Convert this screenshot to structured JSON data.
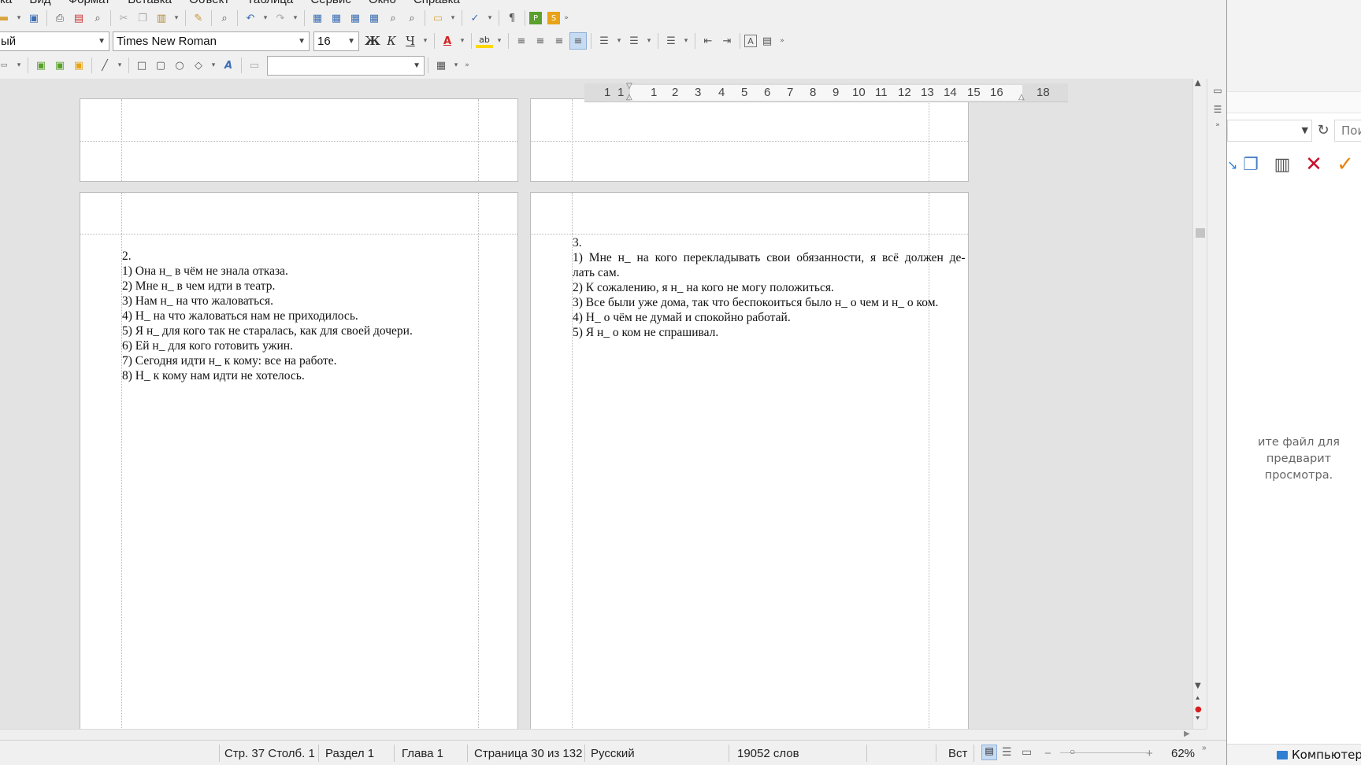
{
  "menubar": {
    "items": [
      "ка",
      "Вид",
      "Формат",
      "Вставка",
      "Объект",
      "Таблица",
      "Сервис",
      "Окно",
      "Справка"
    ]
  },
  "toolbar": {
    "paragraph_style": "ый",
    "font_name": "Times New Roman",
    "font_size": "16",
    "bold_label": "Ж",
    "italic_label": "К",
    "underline_label": "Ч",
    "more_label": "»"
  },
  "ruler": {
    "labels": [
      "1",
      "1",
      "1",
      "2",
      "3",
      "4",
      "5",
      "6",
      "7",
      "8",
      "9",
      "10",
      "11",
      "12",
      "13",
      "14",
      "15",
      "16",
      "18"
    ]
  },
  "left_page": {
    "heading": "2.",
    "lines": [
      "1) Она н_ в чём не знала отказа.",
      "2) Мне н_ в чем идти в театр.",
      "3) Нам н_ на что жаловаться.",
      "4) Н_ на что жаловаться нам не приходилось.",
      "5) Я н_ для кого так не старалась, как для своей дочери.",
      "6) Ей н_ для кого готовить ужин.",
      "7) Сегодня идти н_ к кому: все на работе.",
      "8) Н_ к кому нам идти не хотелось."
    ]
  },
  "right_page": {
    "heading": "3.",
    "lines": [
      "1) Мне н_ на кого перекладывать свои обязанности, я всё должен де-",
      "лать сам.",
      "2) К сожалению, я н_ на кого не могу положиться.",
      "3) Все были уже дома, так что беспокоиться было н_ о чем и н_ о ком.",
      "4) Н_ о чём не думай и спокойно работай.",
      "5) Я н_ о ком не спрашивал."
    ]
  },
  "statusbar": {
    "page_col": "Стр. 37 Столб. 1",
    "section": "Раздел 1",
    "chapter": "Глава 1",
    "page_of": "Страница 30 из 132",
    "language": "Русский",
    "words": "19052 слов",
    "insert_mode": "Вст",
    "zoom": "62%",
    "zoom_minus": "−",
    "zoom_plus": "+"
  },
  "explorer": {
    "search_placeholder": "Пои",
    "preview_line1": "ите файл для предварит",
    "preview_line2": "просмотра.",
    "computer_label": "Компьютер"
  },
  "colors": {
    "accent_blue": "#2f7fd3",
    "delete_red": "#c8102e",
    "confirm_orange": "#e8830c",
    "font_color_red": "#d62020",
    "highlight_yellow": "#ffd800"
  }
}
